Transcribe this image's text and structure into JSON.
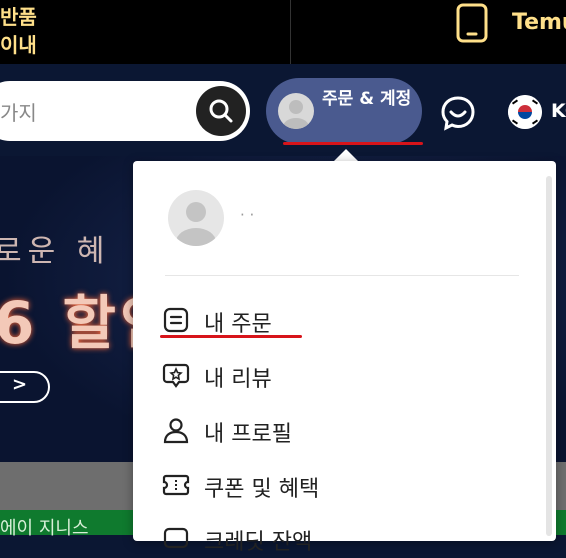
{
  "topbar": {
    "promo_line1": "반품",
    "promo_line2": "이내",
    "brand_text": "Temu"
  },
  "search": {
    "partial_text": "가지"
  },
  "account": {
    "label": "주문 & 계정"
  },
  "language": {
    "code": "KO"
  },
  "banner": {
    "text_line1": "로운 혜",
    "text_line2": "6 할인",
    "arrow": ">"
  },
  "footer": {
    "green_text": "에이 지니스"
  },
  "dropdown": {
    "profile_name": "· ·",
    "items": [
      {
        "label": "내 주문",
        "icon": "orders-icon"
      },
      {
        "label": "내 리뷰",
        "icon": "review-icon"
      },
      {
        "label": "내 프로필",
        "icon": "profile-icon"
      },
      {
        "label": "쿠폰 및 혜택",
        "icon": "coupon-icon"
      },
      {
        "label": "크레딧 잔액",
        "icon": "credit-icon"
      }
    ]
  },
  "colors": {
    "accent_underline": "#d7141a",
    "account_pill": "#4a5a8f",
    "promo_gold": "#ffe08a"
  }
}
